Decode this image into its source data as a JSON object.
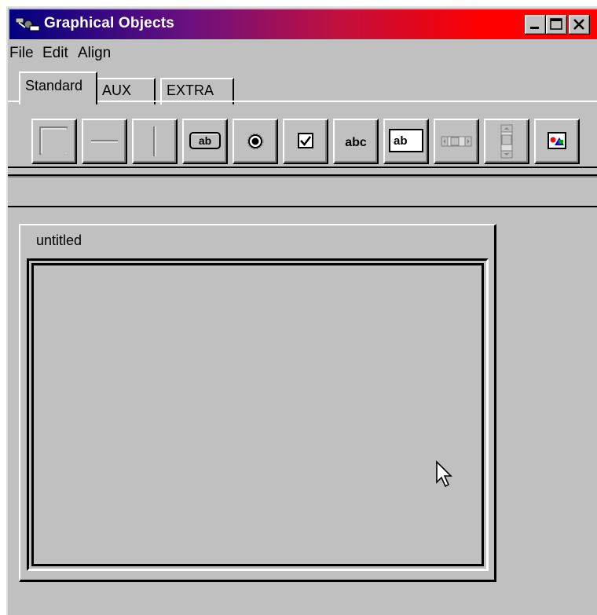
{
  "window": {
    "title": "Graphical Objects",
    "icon": "app-logo-icon",
    "controls": [
      "minimize-icon",
      "maximize-icon",
      "close-icon"
    ]
  },
  "menubar": {
    "items": [
      {
        "label": "File"
      },
      {
        "label": "Edit"
      },
      {
        "label": "Align"
      }
    ]
  },
  "tabs": [
    {
      "label": "Standard",
      "active": true
    },
    {
      "label": "AUX",
      "active": false
    },
    {
      "label": "EXTRA",
      "active": false
    }
  ],
  "tools": [
    {
      "name": "rectangle-tool",
      "icon": "rectangle-icon"
    },
    {
      "name": "horizontal-line-tool",
      "icon": "horizontal-line-icon"
    },
    {
      "name": "vertical-line-tool",
      "icon": "vertical-line-icon"
    },
    {
      "name": "button-tool",
      "icon": "push-button-icon",
      "text": "ab"
    },
    {
      "name": "radio-button-tool",
      "icon": "radio-button-icon"
    },
    {
      "name": "checkbox-tool",
      "icon": "checkbox-icon"
    },
    {
      "name": "label-tool",
      "icon": "static-text-icon",
      "text": "abc"
    },
    {
      "name": "text-field-tool",
      "icon": "text-field-icon",
      "text": "ab"
    },
    {
      "name": "horizontal-scrollbar-tool",
      "icon": "horizontal-scrollbar-icon"
    },
    {
      "name": "vertical-scrollbar-tool",
      "icon": "vertical-scrollbar-icon"
    },
    {
      "name": "image-tool",
      "icon": "picture-icon"
    }
  ],
  "document": {
    "title": "untitled"
  },
  "cursor": {
    "icon": "mouse-pointer-icon"
  },
  "colors": {
    "face": "#c0c0c0",
    "highlight": "#ffffff",
    "shadow": "#808080",
    "dark": "#000000",
    "title_start": "#000080",
    "title_end": "#ff0000"
  }
}
